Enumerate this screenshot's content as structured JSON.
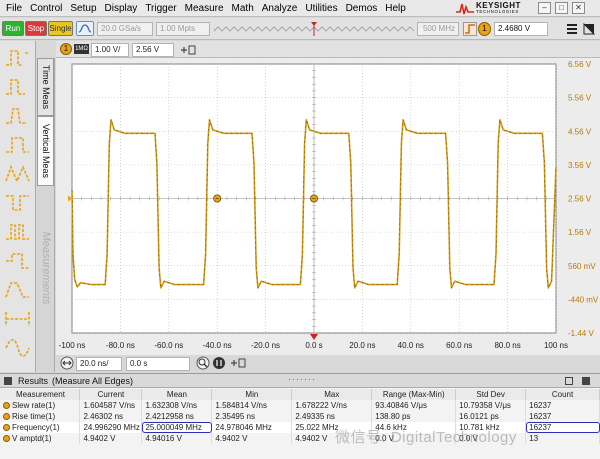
{
  "menu": [
    "File",
    "Control",
    "Setup",
    "Display",
    "Trigger",
    "Measure",
    "Math",
    "Analyze",
    "Utilities",
    "Demos",
    "Help"
  ],
  "logo": {
    "brand": "KEYSIGHT",
    "sub": "TECHNOLOGIES"
  },
  "window_buttons": [
    "–",
    "□",
    "✕"
  ],
  "toolbar": {
    "run": "Run",
    "stop": "Stop",
    "single": "Single",
    "sample_rate": "20.0 GSa/s",
    "memory_depth": "1.00 Mpts",
    "bandwidth": "500 MHz",
    "trigger_level": "2.4680 V",
    "trigger_channel": "1"
  },
  "channel": {
    "number": "1",
    "badge": "1MΩ",
    "scale": "1.00 V/",
    "offset": "2.56 V"
  },
  "side_tabs": {
    "time": "Time Meas",
    "vertical": "Vertical Meas",
    "measurements": "Measurements"
  },
  "colors": {
    "trace": "#d29a12",
    "grid": "#b8b8b8",
    "highlight": "#2a2fb5",
    "run": "#2db32d",
    "stop": "#d43c3c",
    "single": "#e8c820"
  },
  "chart_data": {
    "type": "line",
    "title": "",
    "xlabel": "",
    "ylabel": "",
    "x_ticks": [
      "-100 ns",
      "-80.0 ns",
      "-60.0 ns",
      "-40.0 ns",
      "-20.0 ns",
      "0.0 s",
      "20.0 ns",
      "40.0 ns",
      "60.0 ns",
      "80.0 ns",
      "100 ns"
    ],
    "y_ticks": [
      "6.56 V",
      "5.56 V",
      "4.56 V",
      "3.56 V",
      "2.56 V",
      "1.56 V",
      "560 mV",
      "-440 mV",
      "-1.44 V"
    ],
    "xlim": [
      -100,
      100
    ],
    "ylim": [
      -1.44,
      6.56
    ],
    "grid": true,
    "series": [
      {
        "x": [
          -100,
          -99.6,
          -98.9,
          -97.8,
          -96.4,
          -92,
          -86.3,
          -85.5,
          -84.6,
          -83.9,
          -82.5,
          -78,
          -75.1,
          -71.1,
          -65.7,
          -64.9,
          -64.0,
          -63.3,
          -61.9,
          -57.5,
          -55.0,
          -51.0,
          -45.6,
          -44.8,
          -43.9,
          -43.2,
          -41.8,
          -37.3,
          -35.0,
          -31.0,
          -25.6,
          -24.8,
          -23.9,
          -23.2,
          -21.8,
          -17.3,
          -15.0,
          -11.0,
          -5.6,
          -4.8,
          -3.9,
          -3.2,
          -1.8,
          2.7,
          5.0,
          9.0,
          14.4,
          15.2,
          16.1,
          16.8,
          18.2,
          22.7,
          25.0,
          29.0,
          34.4,
          35.2,
          36.1,
          36.8,
          38.2,
          42.7,
          45.0,
          49.0,
          54.4,
          55.2,
          56.1,
          56.8,
          58.2,
          62.7,
          65.0,
          69.0,
          74.4,
          75.2,
          76.1,
          76.8,
          78.2,
          82.7,
          85.0,
          89.0,
          94.4,
          95.2,
          96.1,
          96.8,
          98.2,
          100
        ],
        "y": [
          2.8,
          0.9,
          0.15,
          -0.07,
          0.06,
          0.0,
          0.0,
          0.9,
          4.2,
          4.9,
          4.6,
          4.5,
          4.5,
          4.5,
          4.5,
          3.6,
          0.5,
          -0.1,
          0.1,
          0.0,
          0.0,
          0.0,
          0.0,
          0.9,
          4.2,
          4.9,
          4.6,
          4.5,
          4.5,
          4.5,
          4.5,
          3.6,
          0.5,
          -0.1,
          0.1,
          0.0,
          0.0,
          0.0,
          0.0,
          0.9,
          4.2,
          4.9,
          4.6,
          4.5,
          4.5,
          4.5,
          4.5,
          3.6,
          0.5,
          -0.1,
          0.1,
          0.0,
          0.0,
          0.0,
          0.0,
          0.9,
          4.2,
          4.9,
          4.6,
          4.5,
          4.5,
          4.5,
          4.5,
          3.6,
          0.5,
          -0.1,
          0.1,
          0.0,
          0.0,
          0.0,
          0.0,
          0.9,
          4.2,
          4.9,
          4.6,
          4.5,
          4.5,
          4.5,
          4.5,
          3.6,
          0.5,
          -0.1,
          0.1,
          3.5
        ]
      }
    ],
    "markers": [
      {
        "x": -40,
        "y": 2.56
      },
      {
        "x": 0,
        "y": 2.56
      }
    ]
  },
  "timebase": {
    "scale": "20.0 ns/",
    "delay": "0.0 s"
  },
  "results": {
    "title": "Results",
    "subtitle": "(Measure All Edges)",
    "columns": [
      "Measurement",
      "Current",
      "Mean",
      "Min",
      "Max",
      "Range (Max-Min)",
      "Std Dev",
      "Count"
    ],
    "rows": [
      [
        "Slew rate(1)",
        "1.604587 V/ns",
        "1.632308 V/ns",
        "1.584814 V/ns",
        "1.678222 V/ns",
        "93.40846 V/μs",
        "10.79358 V/μs",
        "16237"
      ],
      [
        "Rise time(1)",
        "2.46302 ns",
        "2.4212958 ns",
        "2.35495 ns",
        "2.49335 ns",
        "138.80 ps",
        "16.0121 ps",
        "16237"
      ],
      [
        "Frequency(1)",
        "24.996290 MHz",
        "25.000049 MHz",
        "24.978046 MHz",
        "25.022 MHz",
        "44.6 kHz",
        "10.781 kHz",
        "16237"
      ],
      [
        "V amptd(1)",
        "4.9402 V",
        "4.94016 V",
        "4.9402 V",
        "4.9402 V",
        "0.0 V",
        "0.0 V",
        "13"
      ]
    ],
    "watermark": "微信号: DigitalTechnology"
  }
}
